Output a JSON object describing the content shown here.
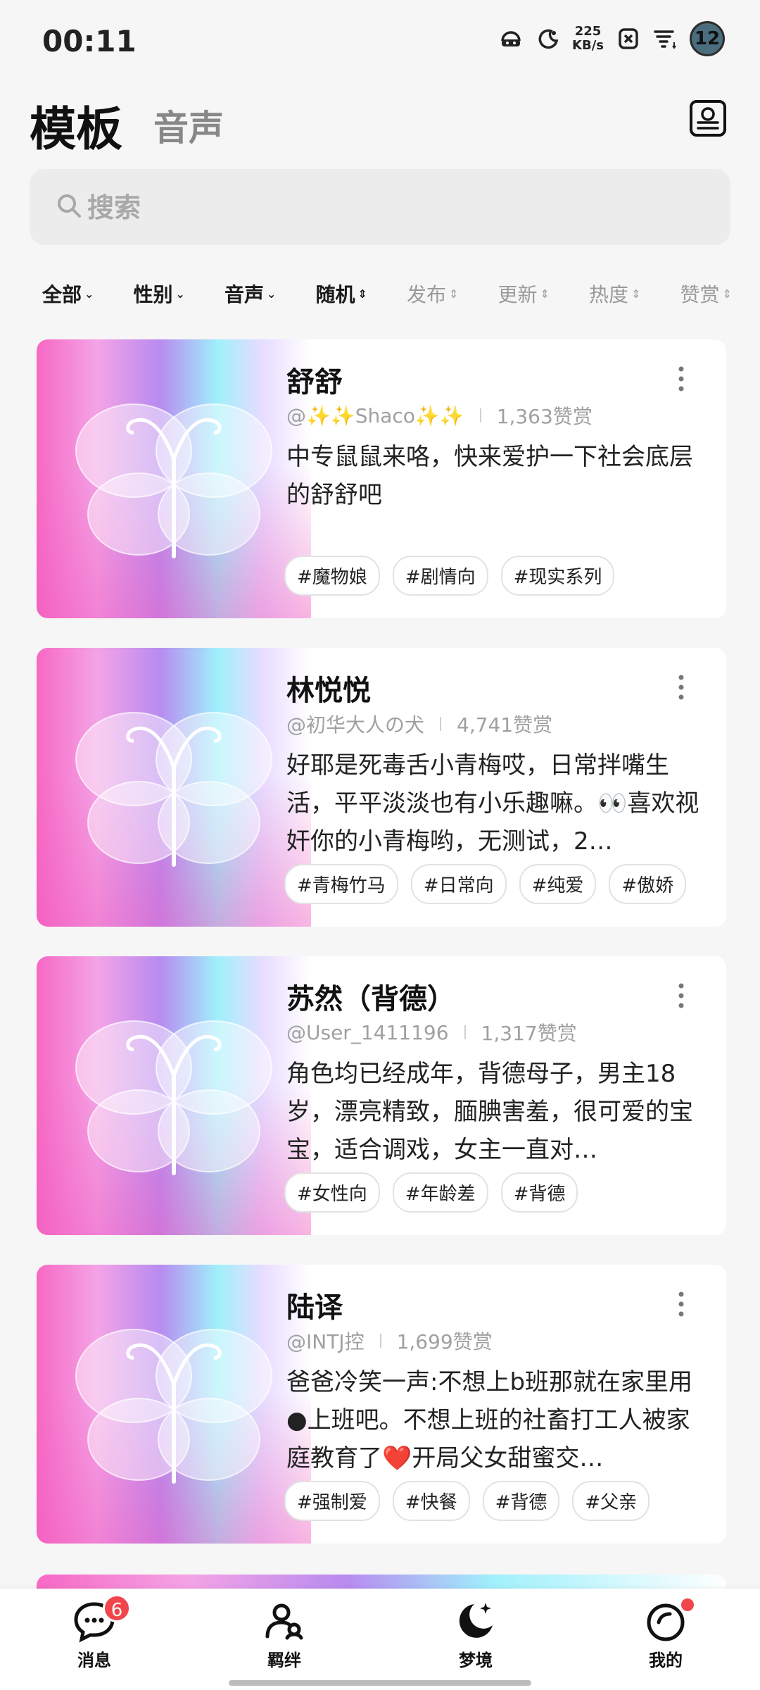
{
  "status_bar": {
    "time": "00:11",
    "net_speed_value": "225",
    "net_speed_unit": "KB/s",
    "battery": "12"
  },
  "header": {
    "tab_active": "模板",
    "tab_inactive": "音声"
  },
  "search": {
    "placeholder": "搜索"
  },
  "filters": [
    {
      "label": "全部",
      "caret": "⌄"
    },
    {
      "label": "性别",
      "caret": "⌄"
    },
    {
      "label": "音声",
      "caret": "⌄"
    },
    {
      "label": "随机",
      "caret": "⇕"
    },
    {
      "label": "发布",
      "caret": "⇕"
    },
    {
      "label": "更新",
      "caret": "⇕"
    },
    {
      "label": "热度",
      "caret": "⇕"
    },
    {
      "label": "赞赏",
      "caret": "⇕"
    }
  ],
  "cards": [
    {
      "name": "舒舒",
      "author": "@✨✨Shaco✨✨",
      "likes": "1,363赞赏",
      "description": "中专鼠鼠来咯，快来爱护一下社会底层的舒舒吧",
      "tags": [
        "#魔物娘",
        "#剧情向",
        "#现实系列"
      ]
    },
    {
      "name": "林悦悦",
      "author": "@初华大人の犬",
      "likes": "4,741赞赏",
      "description": "好耶是死毒舌小青梅哎，日常拌嘴生活，平平淡淡也有小乐趣嘛。👀喜欢视奸你的小青梅哟，无测试，2…",
      "tags": [
        "#青梅竹马",
        "#日常向",
        "#纯爱",
        "#傲娇"
      ]
    },
    {
      "name": "苏然（背德）",
      "author": "@User_1411196",
      "likes": "1,317赞赏",
      "description": "角色均已经成年，背德母子，男主18岁，漂亮精致，腼腆害羞，很可爱的宝宝，适合调戏，女主一直对…",
      "tags": [
        "#女性向",
        "#年龄差",
        "#背德"
      ]
    },
    {
      "name": "陆译",
      "author": "@INTJ控",
      "likes": "1,699赞赏",
      "description": "爸爸冷笑一声:不想上b班那就在家里用●上班吧。不想上班的社畜打工人被家庭教育了❤️开局父女甜蜜交…",
      "tags": [
        "#强制爱",
        "#快餐",
        "#背德",
        "#父亲"
      ]
    }
  ],
  "bottom_nav": {
    "messages": {
      "label": "消息",
      "badge": "6"
    },
    "bonds": {
      "label": "羁绊"
    },
    "dreams": {
      "label": "梦境"
    },
    "me": {
      "label": "我的"
    }
  }
}
